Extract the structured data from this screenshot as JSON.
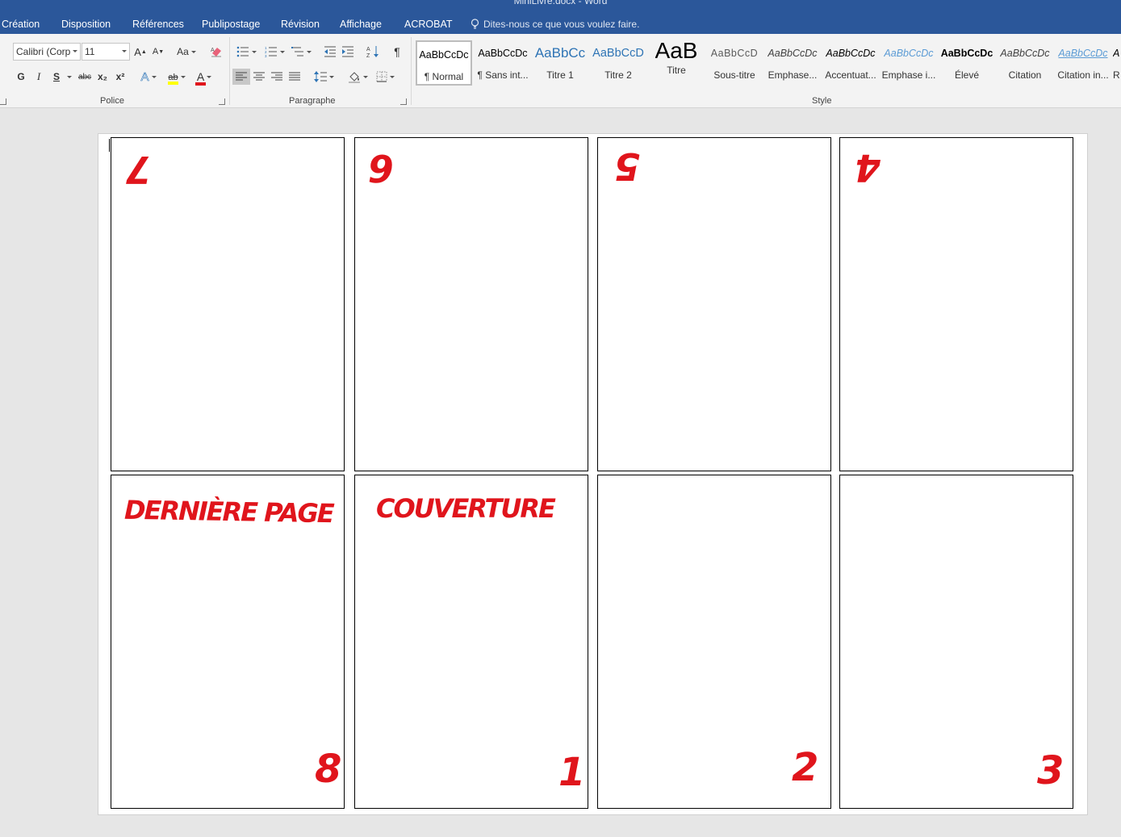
{
  "window": {
    "title": "MiniLivre.docx - Word"
  },
  "tabs": [
    "Création",
    "Disposition",
    "Références",
    "Publipostage",
    "Révision",
    "Affichage",
    "ACROBAT"
  ],
  "tell_me": {
    "text": "Dites-nous ce que vous voulez faire."
  },
  "font": {
    "family_value": "Calibri (Corp",
    "size_value": "11",
    "grow_label": "A",
    "shrink_label": "A",
    "case_label": "Aa",
    "bold_label": "G",
    "italic_label": "I",
    "underline_label": "S",
    "strike_label": "abc",
    "subscript_label": "x₂",
    "superscript_label": "x²",
    "effects_label": "A",
    "highlight_label": "ab",
    "color_label": "A",
    "group_label": "Police"
  },
  "paragraph": {
    "group_label": "Paragraphe",
    "pilcrow": "¶"
  },
  "styles": {
    "group_label": "Style",
    "items": [
      {
        "preview": "AaBbCcDc",
        "name": "¶ Normal"
      },
      {
        "preview": "AaBbCcDc",
        "name": "¶ Sans int..."
      },
      {
        "preview": "AaBbCc",
        "name": "Titre 1"
      },
      {
        "preview": "AaBbCcD",
        "name": "Titre 2"
      },
      {
        "preview": "AaB",
        "name": "Titre"
      },
      {
        "preview": "AaBbCcD",
        "name": "Sous-titre"
      },
      {
        "preview": "AaBbCcDc",
        "name": "Emphase..."
      },
      {
        "preview": "AaBbCcDc",
        "name": "Accentuat..."
      },
      {
        "preview": "AaBbCcDc",
        "name": "Emphase i..."
      },
      {
        "preview": "AaBbCcDc",
        "name": "Élevé"
      },
      {
        "preview": "AaBbCcDc",
        "name": "Citation"
      },
      {
        "preview": "AaBbCcDc",
        "name": "Citation in..."
      },
      {
        "preview": "A",
        "name": "R"
      }
    ]
  },
  "document": {
    "top_row": [
      "7",
      "6",
      "5",
      "4"
    ],
    "bottom_row": {
      "labels": [
        "DERNIÈRE PAGE",
        "COUVERTURE",
        "",
        ""
      ],
      "numbers": [
        "8",
        "1",
        "2",
        "3"
      ]
    }
  },
  "colors": {
    "title_bar": "#2b579a",
    "ribbon": "#f3f3f3",
    "annotation": "#e0151c",
    "heading_blue": "#2e74b5"
  }
}
